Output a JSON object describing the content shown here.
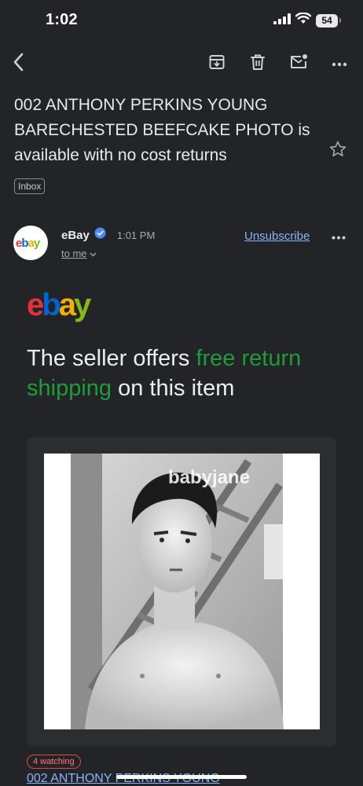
{
  "status_bar": {
    "time": "1:02",
    "battery": "54"
  },
  "toolbar": {
    "back_icon": "chevron-left-icon",
    "archive_icon": "archive-icon",
    "delete_icon": "trash-icon",
    "mark_unread_icon": "mail-unread-icon",
    "more_icon": "more-horizontal-icon"
  },
  "email": {
    "subject": "002 ANTHONY PERKINS YOUNG BARECHESTED BEEFCAKE PHOTO is available with no cost returns",
    "label": "Inbox",
    "sender": {
      "name": "eBay",
      "time": "1:01 PM",
      "recipient": "to me",
      "avatar_text": "ebay",
      "unsubscribe": "Unsubscribe"
    }
  },
  "body": {
    "logo_text": "ebay",
    "headline_part1": "The seller offers ",
    "headline_highlight": "free return shipping",
    "headline_part2": " on this item",
    "photo_watermark": "babyjane",
    "watching_badge": "4 watching",
    "item_title": "002 ANTHONY PERKINS YOUNG"
  },
  "colors": {
    "background": "#232428",
    "link": "#8ab4f8",
    "highlight_green": "#1f9b3a",
    "ebay_red": "#e53238",
    "ebay_blue": "#0064d2",
    "ebay_yellow": "#f5af02",
    "ebay_green": "#86b817",
    "verified_blue": "#4a8af4"
  }
}
